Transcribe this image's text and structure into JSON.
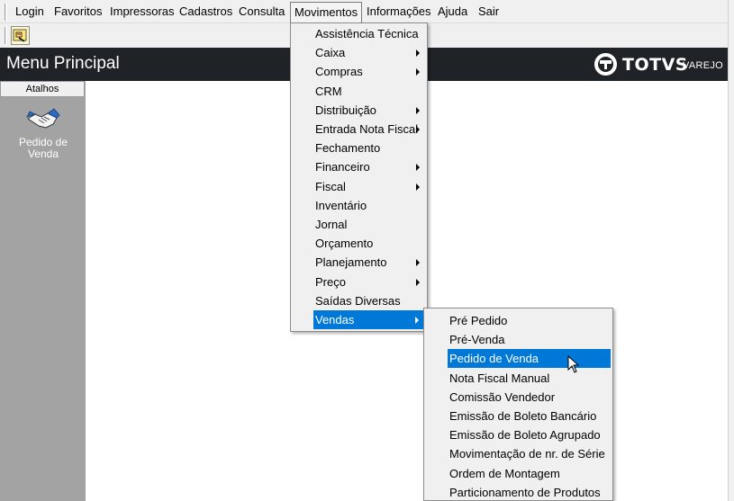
{
  "menubar": {
    "items": [
      "Login",
      "Favoritos",
      "Impressoras",
      "Cadastros",
      "Consulta",
      "Movimentos",
      "Informações",
      "Ajuda",
      "Sair"
    ],
    "active": "Movimentos"
  },
  "toolbar": {
    "button_icon": "favorites-icon"
  },
  "header": {
    "title": "Menu Principal",
    "logo_text": "TOTVS",
    "logo_sub": "VAREJO"
  },
  "sidebar": {
    "tab_label": "Atalhos",
    "shortcut_line1": "Pedido de",
    "shortcut_line2": "Venda",
    "shortcut_icon": "handshake-icon"
  },
  "movimentos_menu": [
    {
      "label": "Assistência Técnica",
      "arrow": false
    },
    {
      "label": "Caixa",
      "arrow": true
    },
    {
      "label": "Compras",
      "arrow": true
    },
    {
      "label": "CRM",
      "arrow": false
    },
    {
      "label": "Distribuição",
      "arrow": true
    },
    {
      "label": "Entrada Nota Fiscal",
      "arrow": true
    },
    {
      "label": "Fechamento",
      "arrow": false
    },
    {
      "label": "Financeiro",
      "arrow": true
    },
    {
      "label": "Fiscal",
      "arrow": true
    },
    {
      "label": "Inventário",
      "arrow": false
    },
    {
      "label": "Jornal",
      "arrow": false
    },
    {
      "label": "Orçamento",
      "arrow": false
    },
    {
      "label": "Planejamento",
      "arrow": true
    },
    {
      "label": "Preço",
      "arrow": true
    },
    {
      "label": "Saídas Diversas",
      "arrow": false
    },
    {
      "label": "Vendas",
      "arrow": true,
      "selected": true
    }
  ],
  "vendas_submenu": [
    {
      "label": "Pré Pedido"
    },
    {
      "label": "Pré-Venda"
    },
    {
      "label": "Pedido de Venda",
      "selected": true
    },
    {
      "label": "Nota Fiscal Manual"
    },
    {
      "label": "Comissão Vendedor"
    },
    {
      "label": "Emissão de Boleto Bancário"
    },
    {
      "label": "Emissão de Boleto Agrupado"
    },
    {
      "label": "Movimentação de nr. de Série"
    },
    {
      "label": "Ordem de Montagem"
    },
    {
      "label": "Particionamento de Produtos"
    }
  ],
  "colors": {
    "highlight": "#0078d7",
    "header_bg": "#1f2327",
    "sidebar_bg": "#a3a3a3",
    "menu_bg": "#f0f0f0"
  }
}
